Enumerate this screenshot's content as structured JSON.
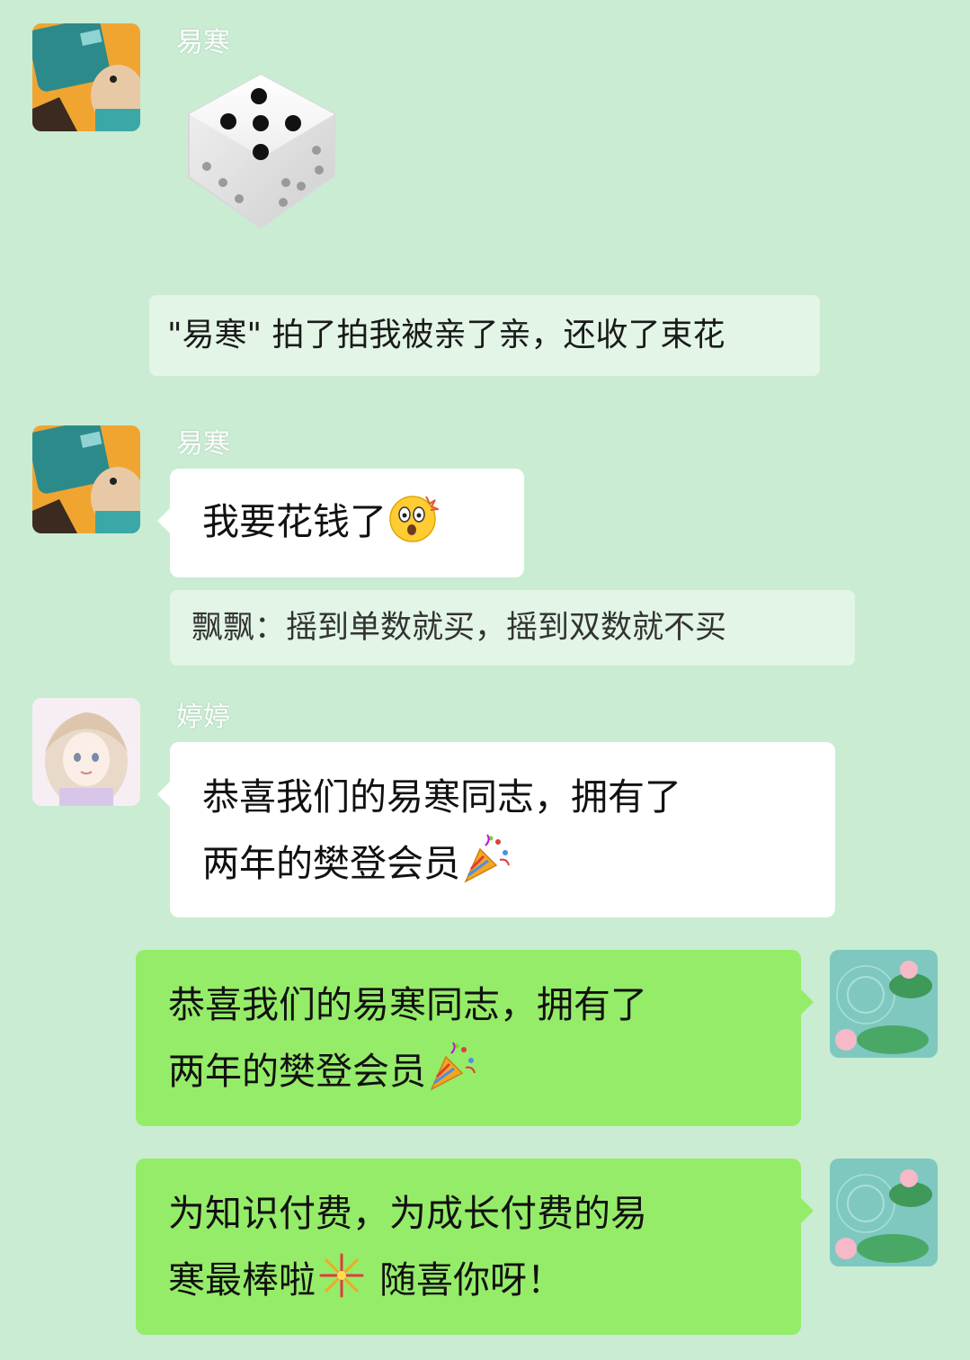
{
  "messages": [
    {
      "sender": "易寒",
      "type": "dice",
      "dice_value": 5
    },
    {
      "type": "system",
      "text": "\"易寒\" 拍了拍我被亲了亲，还收了束花"
    },
    {
      "sender": "易寒",
      "type": "text",
      "text": "我要花钱了",
      "emoji": "shocked-face-emoji"
    },
    {
      "type": "quote",
      "text": "飘飘：摇到单数就买，摇到双数就不买"
    },
    {
      "sender": "婷婷",
      "type": "text",
      "text_line1": "恭喜我们的易寒同志，拥有了",
      "text_line2": "两年的樊登会员",
      "emoji": "party-popper-emoji"
    },
    {
      "sender": "me",
      "type": "text",
      "text_line1": "恭喜我们的易寒同志，拥有了",
      "text_line2": "两年的樊登会员",
      "emoji": "party-popper-emoji"
    },
    {
      "sender": "me",
      "type": "text",
      "text_line1": "为知识付费，为成长付费的易",
      "text_line2_a": "寒最棒啦",
      "text_line2_b": "随喜你呀！",
      "emoji": "fireworks-emoji"
    }
  ],
  "colors": {
    "background": "#c9ecd3",
    "incoming_bubble": "#ffffff",
    "outgoing_bubble": "#95ec69",
    "system_bg": "#e2f5e6"
  }
}
